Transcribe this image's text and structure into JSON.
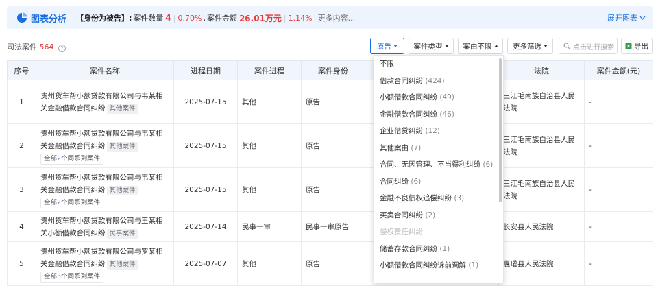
{
  "banner": {
    "title": "图表分析",
    "lead": "【身份为被告】:",
    "count_label": "案件数量",
    "count_value": "4",
    "count_pct": "0.70%",
    "amount_label": "案件金额",
    "amount_value": "26.01万元",
    "amount_pct": "1.14%",
    "more": "更多内容...",
    "expand": "展开图表"
  },
  "toolbar": {
    "count_label": "司法案件",
    "count_value": "564",
    "filters": [
      {
        "label": "原告",
        "active": true
      },
      {
        "label": "案件类型",
        "active": false
      },
      {
        "label": "案由不限",
        "active": false
      },
      {
        "label": "更多筛选",
        "active": false
      }
    ],
    "search_placeholder": "点击进行搜索",
    "export_label": "导出"
  },
  "table": {
    "headers": [
      "序号",
      "案件名称",
      "进程日期",
      "案件进程",
      "案件身份",
      "",
      "法院",
      "案件金额(元)"
    ],
    "rows": [
      {
        "no": "1",
        "name": "贵州货车帮小额贷款有限公司与韦某相关金融借款合同纠纷",
        "tag": "其他案件",
        "series_pre": "",
        "series_num": "",
        "series_post": "",
        "date": "2025-07-15",
        "progress": "其他",
        "role": "原告",
        "court": "三江毛南族自治县人民法院",
        "amount": "-"
      },
      {
        "no": "2",
        "name": "贵州货车帮小额贷款有限公司与韦某相关金融借款合同纠纷",
        "tag": "其他案件",
        "series_pre": "全部",
        "series_num": "2",
        "series_post": "个同系列案件",
        "date": "2025-07-15",
        "progress": "其他",
        "role": "原告",
        "court": "三江毛南族自治县人民法院",
        "amount": "-"
      },
      {
        "no": "3",
        "name": "贵州货车帮小额贷款有限公司与韦某相关金融借款合同纠纷",
        "tag": "其他案件",
        "series_pre": "全部",
        "series_num": "2",
        "series_post": "个同系列案件",
        "date": "2025-07-15",
        "progress": "其他",
        "role": "原告",
        "court": "三江毛南族自治县人民法院",
        "amount": "-"
      },
      {
        "no": "4",
        "name": "贵州货车帮小额贷款有限公司与王某相关小额借款合同纠纷",
        "tag": "民事案件",
        "series_pre": "",
        "series_num": "",
        "series_post": "",
        "date": "2025-07-14",
        "progress": "民事一审",
        "role": "民事一审原告",
        "court": "长安县人民法院",
        "amount": "-"
      },
      {
        "no": "5",
        "name": "贵州货车帮小额贷款有限公司与罗某相关金融借款合同纠纷",
        "tag": "其他案件",
        "series_pre": "全部",
        "series_num": "3",
        "series_post": "个同系列案件",
        "date": "2025-07-07",
        "progress": "其他",
        "role": "原告",
        "court": "惠瓘县人民法院",
        "amount": "-"
      }
    ]
  },
  "dropdown": {
    "items": [
      {
        "label": "不限",
        "count": "",
        "disabled": false
      },
      {
        "label": "借款合同纠纷",
        "count": "(424)",
        "disabled": false
      },
      {
        "label": "小额借款合同纠纷",
        "count": "(49)",
        "disabled": false
      },
      {
        "label": "金融借款合同纠纷",
        "count": "(46)",
        "disabled": false
      },
      {
        "label": "企业借贷纠纷",
        "count": "(12)",
        "disabled": false
      },
      {
        "label": "其他案由",
        "count": "(7)",
        "disabled": false
      },
      {
        "label": "合同、无因管理、不当得利纠纷",
        "count": "(6)",
        "disabled": false
      },
      {
        "label": "合同纠纷",
        "count": "(6)",
        "disabled": false
      },
      {
        "label": "金融不良债权追偿纠纷",
        "count": "(3)",
        "disabled": false
      },
      {
        "label": "买卖合同纠纷",
        "count": "(2)",
        "disabled": false
      },
      {
        "label": "侵权责任纠纷",
        "count": "",
        "disabled": true
      },
      {
        "label": "储蓄存款合同纠纷",
        "count": "(1)",
        "disabled": false
      },
      {
        "label": "小额借款合同纠纷诉前调解",
        "count": "(1)",
        "disabled": false
      }
    ]
  },
  "colors": {
    "accent": "#1a6fe0",
    "red": "#e23b3b",
    "banner_bg": "#edf4fd",
    "header_bg": "#f1f6fd"
  },
  "icons": {
    "chart": "chart-icon",
    "chevron": "chevron-down-icon",
    "search": "search-icon",
    "export": "export-icon",
    "help": "help-icon"
  }
}
